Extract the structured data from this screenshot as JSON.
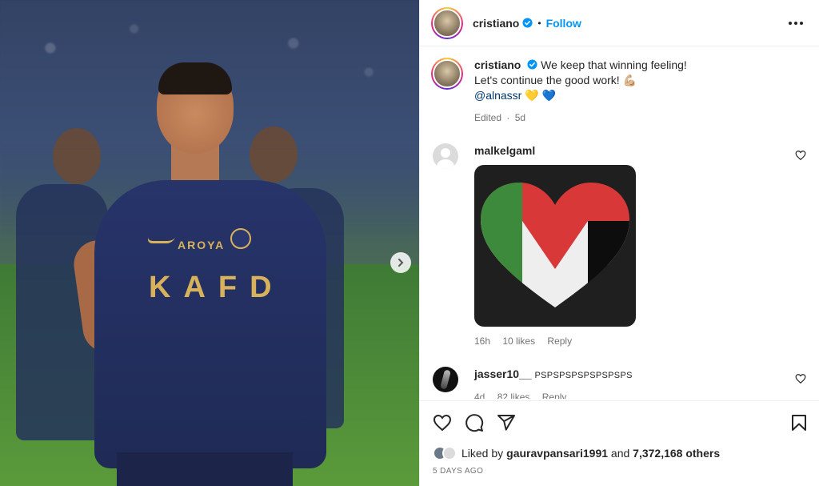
{
  "post": {
    "username": "cristiano",
    "follow_label": "Follow",
    "dot": "•"
  },
  "caption": {
    "username": "cristiano",
    "line1": "We keep that winning feeling!",
    "line2": "Let's continue the good work! 💪🏼",
    "mention": "@alnassr",
    "emojis": "💛 💙",
    "edited": "Edited",
    "age": "5d",
    "sep": "·"
  },
  "comments": [
    {
      "username": "malkelgaml",
      "time": "16h",
      "likes": "10 likes",
      "reply": "Reply"
    },
    {
      "username": "jasser10__",
      "text": "PSPSPSPSPSPSPSPS",
      "time": "4d",
      "likes": "82 likes",
      "reply": "Reply"
    }
  ],
  "jersey": {
    "sponsor_top": "AROYA",
    "sponsor_main": "KAFD"
  },
  "footer": {
    "liked_by_prefix": "Liked by ",
    "liked_by_user": "gauravpansari1991",
    "and": " and ",
    "others": "7,372,168 others",
    "posted": "5 DAYS AGO"
  },
  "icons": {
    "like": "heart-icon",
    "comment": "comment-icon",
    "share": "send-icon",
    "save": "bookmark-icon",
    "next": "chevron-right-icon",
    "more": "more-icon",
    "verified": "verified-badge-icon"
  },
  "colors": {
    "accent": "#0095f6",
    "verified": "#0095f6",
    "muted": "#737373"
  }
}
